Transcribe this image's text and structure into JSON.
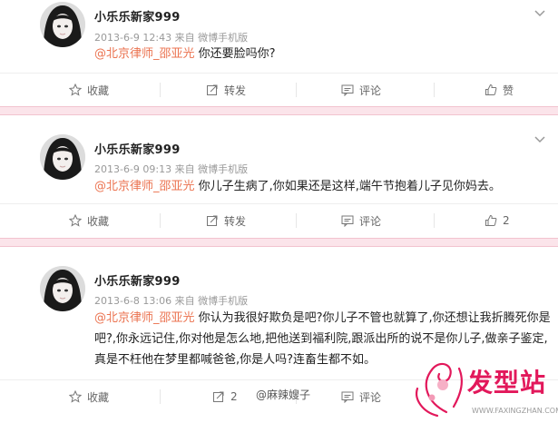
{
  "posts": [
    {
      "username": "小乐乐新家999",
      "meta": "2013-6-9 12:43 来自 微博手机版",
      "mention": "@北京律师_邵亚光",
      "text": " 你还要脸吗你?",
      "actions": {
        "favorite": "收藏",
        "repost": "转发",
        "comment": "评论",
        "like": "赞"
      }
    },
    {
      "username": "小乐乐新家999",
      "meta": "2013-6-9 09:13 来自 微博手机版",
      "mention": "@北京律师_邵亚光",
      "text": " 你儿子生病了,你如果还是这样,端午节抱着儿子见你妈去。",
      "actions": {
        "favorite": "收藏",
        "repost": "转发",
        "comment": "评论",
        "like": "2"
      }
    },
    {
      "username": "小乐乐新家999",
      "meta": "2013-6-8 13:06 来自 微博手机版",
      "mention": "@北京律师_邵亚光",
      "text": " 你认为我很好欺负是吧?你儿子不管也就算了,你还想让我折腾死你是吧?,你永远记住,你对他是怎么地,把他送到福利院,跟派出所的说不是你儿子,做亲子鉴定,真是不枉他在梦里都喊爸爸,你是人吗?连畜生都不如。",
      "actions": {
        "favorite": "收藏",
        "repost": "2",
        "comment": "评论"
      }
    }
  ],
  "watermark": {
    "handle": "@麻辣嫂子",
    "logo_text": "发型站",
    "logo_url": "WWW.FAXINGZHAN.COM"
  },
  "colors": {
    "mention": "#eb7350",
    "separator": "#fbe4ea",
    "logo": "#e2185b"
  }
}
